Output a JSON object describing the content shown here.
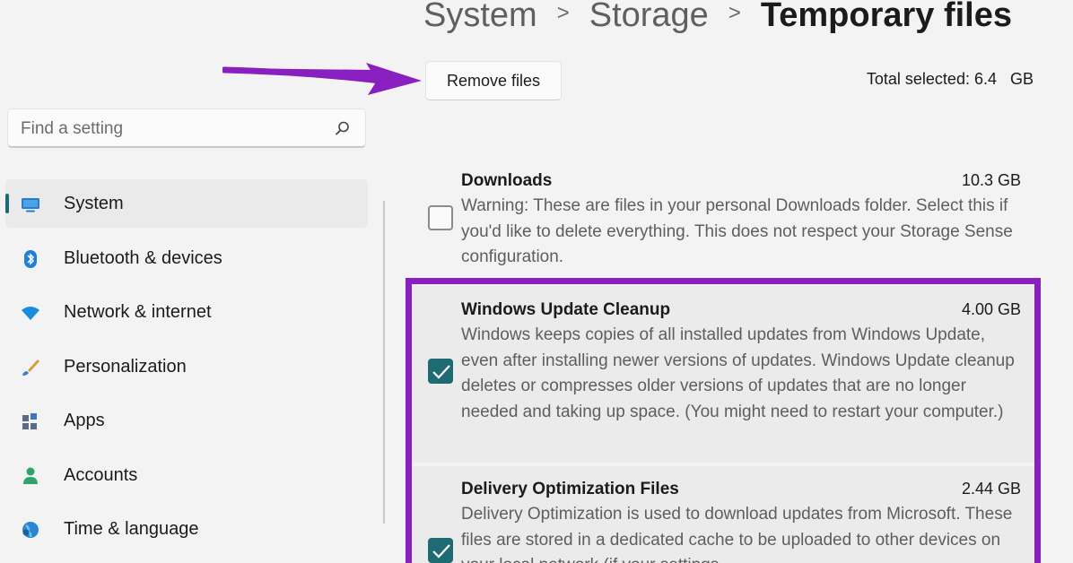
{
  "breadcrumb": {
    "items": [
      "System",
      "Storage"
    ],
    "separator": ">",
    "current": "Temporary files"
  },
  "toolbar": {
    "remove_label": "Remove files",
    "total_selected": "Total selected: 6.4   GB"
  },
  "search": {
    "placeholder": "Find a setting",
    "icon": "search-icon"
  },
  "sidebar": {
    "items": [
      {
        "label": "System",
        "icon": "system-icon",
        "active": true
      },
      {
        "label": "Bluetooth & devices",
        "icon": "bluetooth-icon"
      },
      {
        "label": "Network & internet",
        "icon": "wifi-icon"
      },
      {
        "label": "Personalization",
        "icon": "brush-icon"
      },
      {
        "label": "Apps",
        "icon": "apps-icon"
      },
      {
        "label": "Accounts",
        "icon": "person-icon"
      },
      {
        "label": "Time & language",
        "icon": "globe-icon"
      }
    ]
  },
  "files": [
    {
      "title": "Downloads",
      "size": "10.3 GB",
      "checked": false,
      "description": "Warning: These are files in your personal Downloads folder. Select this if you'd like to delete everything. This does not respect your Storage Sense configuration."
    },
    {
      "title": "Windows Update Cleanup",
      "size": "4.00 GB",
      "checked": true,
      "description": "Windows keeps copies of all installed updates from Windows Update, even after installing newer versions of updates. Windows Update cleanup deletes or compresses older versions of updates that are no longer needed and taking up space. (You might need to restart your computer.)"
    },
    {
      "title": "Delivery Optimization Files",
      "size": "2.44 GB",
      "checked": true,
      "description": "Delivery Optimization is used to download updates from Microsoft. These files are stored in a dedicated cache to be uploaded to other devices on your local network (if your settings"
    }
  ],
  "colors": {
    "accent": "#1f6b73",
    "highlight": "#8a1fbf",
    "arrow": "#8a1fbf"
  }
}
